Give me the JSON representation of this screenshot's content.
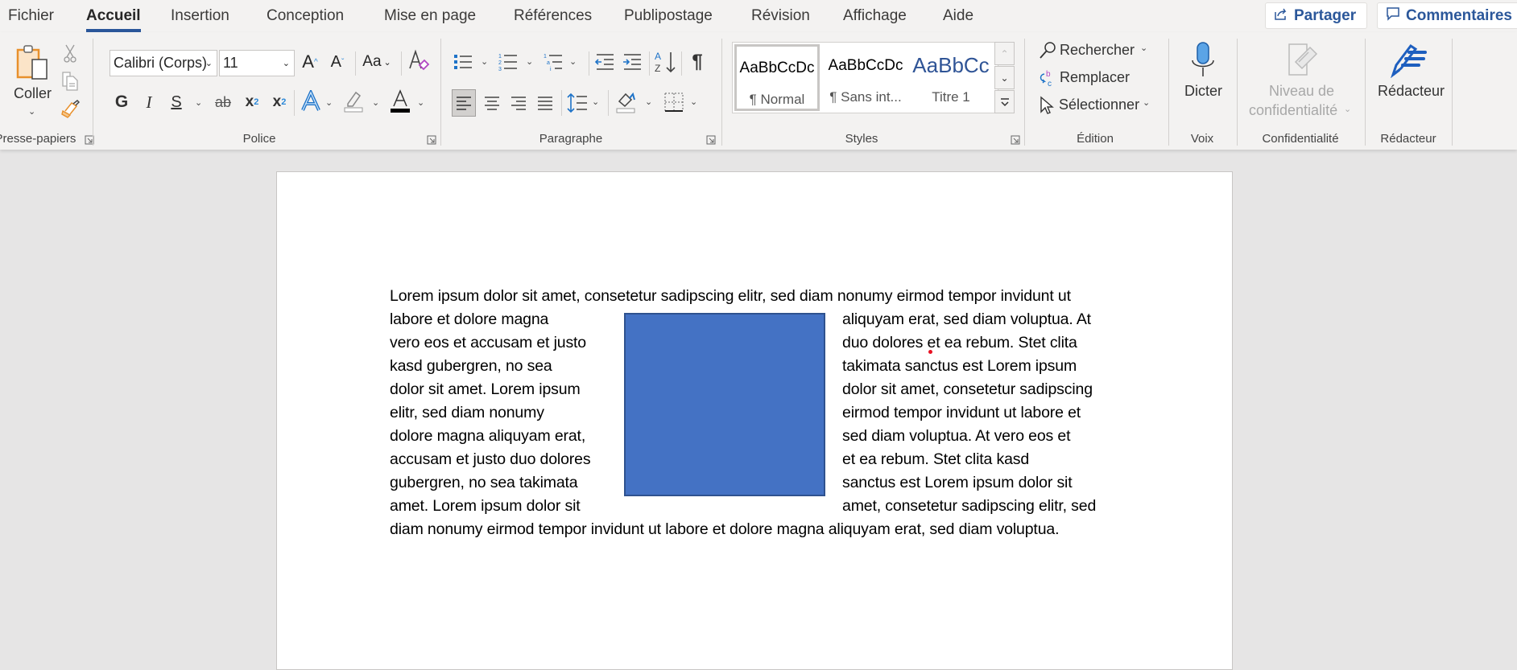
{
  "menu_tabs": [
    {
      "label": "Fichier",
      "active": false
    },
    {
      "label": "Accueil",
      "active": true
    },
    {
      "label": "Insertion",
      "active": false
    },
    {
      "label": "Conception",
      "active": false
    },
    {
      "label": "Mise en page",
      "active": false
    },
    {
      "label": "Références",
      "active": false
    },
    {
      "label": "Publipostage",
      "active": false
    },
    {
      "label": "Révision",
      "active": false
    },
    {
      "label": "Affichage",
      "active": false
    },
    {
      "label": "Aide",
      "active": false
    }
  ],
  "top_actions": {
    "share_label": "Partager",
    "comments_label": "Commentaires"
  },
  "ribbon": {
    "clipboard": {
      "group_label": "Presse-papiers",
      "paste_label": "Coller",
      "icons": [
        "paste-icon",
        "cut-icon",
        "copy-icon",
        "format-painter-icon"
      ]
    },
    "font": {
      "group_label": "Police",
      "font_name": "Calibri (Corps)",
      "font_size": "11",
      "buttons": [
        "grow-font",
        "shrink-font",
        "change-case",
        "clear-formatting",
        "bold",
        "italic",
        "underline",
        "strikethrough",
        "subscript",
        "superscript",
        "text-effects",
        "highlight",
        "font-color"
      ],
      "bold_glyph": "G",
      "italic_glyph": "I",
      "underline_glyph": "S",
      "strike_glyph": "ab",
      "change_case_glyph": "Aa",
      "font_color": "#000000",
      "highlight_color": "#ffffff"
    },
    "paragraph": {
      "group_label": "Paragraphe",
      "pilcrow_glyph": "¶",
      "active_alignment": "left"
    },
    "styles": {
      "group_label": "Styles",
      "items": [
        {
          "preview": "AaBbCcDc",
          "name": "¶ Normal",
          "selected": true
        },
        {
          "preview": "AaBbCcDc",
          "name": "¶ Sans int...",
          "selected": false
        },
        {
          "preview": "AaBbCc",
          "name": "Titre 1",
          "selected": false
        }
      ]
    },
    "editing": {
      "group_label": "Édition",
      "find_label": "Rechercher",
      "replace_label": "Remplacer",
      "select_label": "Sélectionner"
    },
    "voice": {
      "group_label": "Voix",
      "dictate_label": "Dicter"
    },
    "sensitivity": {
      "group_label": "Confidentialité",
      "label_line1": "Niveau de",
      "label_line2": "confidentialité",
      "disabled": true
    },
    "editor": {
      "group_label": "Rédacteur",
      "editor_label": "Rédacteur"
    }
  },
  "document": {
    "shape_color": "#4472c4",
    "shape_border_color": "#2f528f",
    "lines_full_top": "Lorem ipsum dolor sit amet, consetetur sadipscing elitr, sed diam nonumy eirmod tempor invidunt ut",
    "lines_left": [
      "labore et dolore magna",
      "vero eos et accusam et justo",
      "kasd gubergren, no sea",
      "dolor sit amet. Lorem ipsum",
      "elitr, sed diam nonumy",
      "dolore magna aliquyam erat,",
      "accusam et justo duo dolores",
      "gubergren, no sea takimata",
      "amet. Lorem ipsum dolor sit"
    ],
    "lines_right": [
      "aliquyam erat, sed diam voluptua. At",
      "duo dolores et ea rebum. Stet clita",
      "takimata sanctus est Lorem ipsum",
      "dolor sit amet, consetetur sadipscing",
      "eirmod tempor invidunt ut labore et",
      "sed diam voluptua. At vero eos et",
      "et ea rebum. Stet clita kasd",
      "sanctus est Lorem ipsum dolor sit",
      "amet, consetetur sadipscing elitr, sed"
    ],
    "lines_full_bottom": "diam nonumy eirmod tempor invidunt ut labore et dolore magna aliquyam erat, sed diam voluptua."
  }
}
